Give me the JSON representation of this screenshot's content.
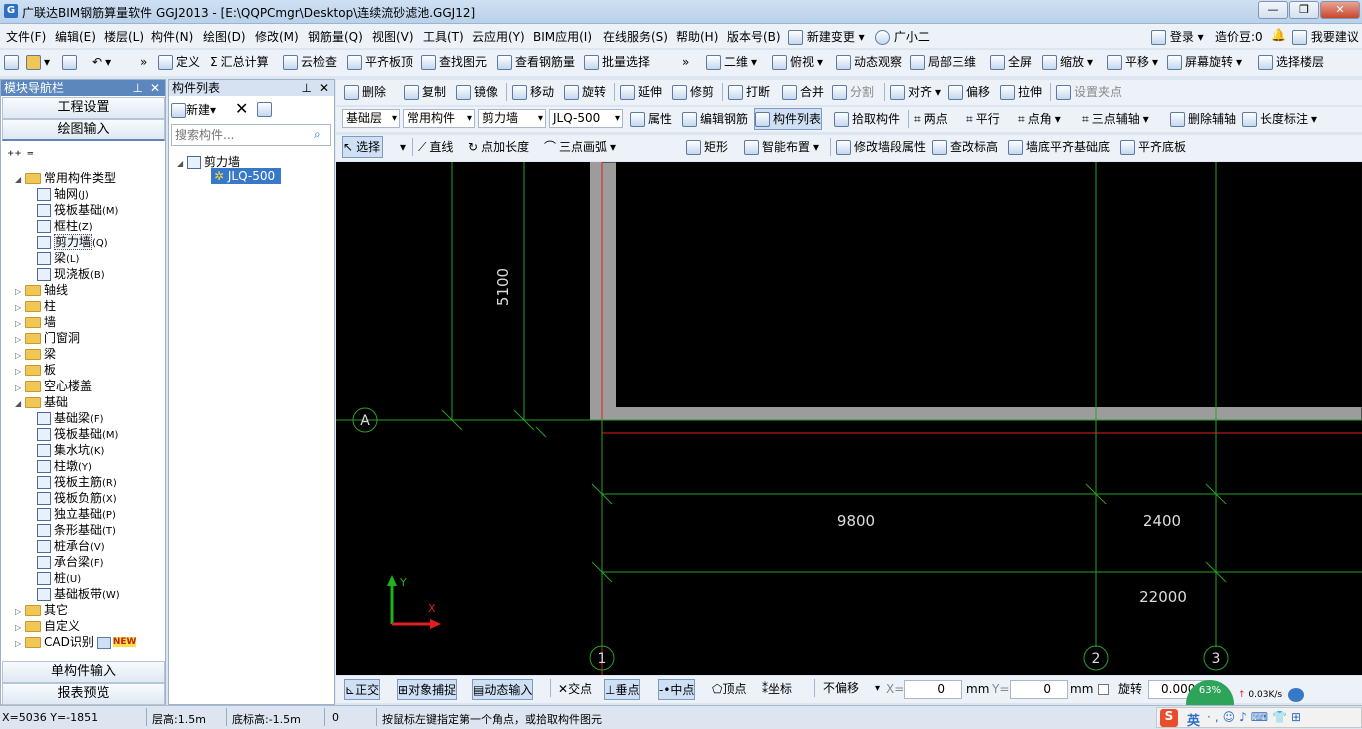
{
  "window": {
    "title": "广联达BIM钢筋算量软件 GGJ2013 - [E:\\QQPCmgr\\Desktop\\连续流砂滤池.GGJ12]",
    "app_icon": "G"
  },
  "menu": [
    "文件(F)",
    "编辑(E)",
    "楼层(L)",
    "构件(N)",
    "绘图(D)",
    "修改(M)",
    "钢筋量(Q)",
    "视图(V)",
    "工具(T)",
    "云应用(Y)",
    "BIM应用(I)",
    "在线服务(S)",
    "帮助(H)",
    "版本号(B)",
    "新建变更",
    "广小二"
  ],
  "menu_right": {
    "login": "登录",
    "price_beans": "造价豆:0",
    "suggest": "我要建议"
  },
  "toolbar1": {
    "define": "定义",
    "sum": "汇总计算",
    "cloud_check": "云检查",
    "flush_top": "平齐板顶",
    "find": "查找图元",
    "view_rebar": "查看钢筋量",
    "batch_select": "批量选择",
    "view_2d": "二维",
    "top_view": "俯视",
    "dyn_view": "动态观察",
    "local_3d": "局部三维",
    "fullscreen": "全屏",
    "zoom": "缩放",
    "pan": "平移",
    "rotate": "屏幕旋转",
    "choose_floor": "选择楼层"
  },
  "toolbar2": {
    "delete": "删除",
    "copy": "复制",
    "mirror": "镜像",
    "move": "移动",
    "rotate": "旋转",
    "extend": "延伸",
    "trim": "修剪",
    "break": "打断",
    "merge": "合并",
    "split": "分割",
    "align": "对齐",
    "offset": "偏移",
    "stretch": "拉伸",
    "set_grip": "设置夹点"
  },
  "toolbar3": {
    "layer": "基础层",
    "type": "常用构件",
    "category": "剪力墙",
    "component": "JLQ-500",
    "props": "属性",
    "edit_rebar": "编辑钢筋",
    "comp_list": "构件列表",
    "pick": "拾取构件",
    "two_point": "两点",
    "parallel": "平行",
    "point_angle": "点角",
    "three_axis": "三点辅轴",
    "del_axis": "删除辅轴",
    "length_dim": "长度标注"
  },
  "toolbar4": {
    "select": "选择",
    "line": "直线",
    "point_len": "点加长度",
    "arc3": "三点画弧",
    "rect": "矩形",
    "smart": "智能布置",
    "modify_seg": "修改墙段属性",
    "check_elev": "查改标高",
    "wall_flush": "墙底平齐基础底",
    "flush_bottom": "平齐底板"
  },
  "left_nav": {
    "title": "模块导航栏",
    "btn_project": "工程设置",
    "btn_draw": "绘图输入",
    "btn_single": "单构件输入",
    "btn_report": "报表预览",
    "tree": [
      {
        "label": "常用构件类型",
        "level": 0,
        "type": "folder",
        "open": true
      },
      {
        "label": "轴网",
        "key": "(J)",
        "level": 1,
        "type": "leaf"
      },
      {
        "label": "筏板基础",
        "key": "(M)",
        "level": 1,
        "type": "leaf"
      },
      {
        "label": "框柱",
        "key": "(Z)",
        "level": 1,
        "type": "leaf"
      },
      {
        "label": "剪力墙",
        "key": "(Q)",
        "level": 1,
        "type": "leaf",
        "selected": true
      },
      {
        "label": "梁",
        "key": "(L)",
        "level": 1,
        "type": "leaf"
      },
      {
        "label": "现浇板",
        "key": "(B)",
        "level": 1,
        "type": "leaf"
      },
      {
        "label": "轴线",
        "level": 0,
        "type": "folder"
      },
      {
        "label": "柱",
        "level": 0,
        "type": "folder"
      },
      {
        "label": "墙",
        "level": 0,
        "type": "folder"
      },
      {
        "label": "门窗洞",
        "level": 0,
        "type": "folder"
      },
      {
        "label": "梁",
        "level": 0,
        "type": "folder"
      },
      {
        "label": "板",
        "level": 0,
        "type": "folder"
      },
      {
        "label": "空心楼盖",
        "level": 0,
        "type": "folder"
      },
      {
        "label": "基础",
        "level": 0,
        "type": "folder",
        "open": true
      },
      {
        "label": "基础梁",
        "key": "(F)",
        "level": 1,
        "type": "leaf"
      },
      {
        "label": "筏板基础",
        "key": "(M)",
        "level": 1,
        "type": "leaf"
      },
      {
        "label": "集水坑",
        "key": "(K)",
        "level": 1,
        "type": "leaf"
      },
      {
        "label": "柱墩",
        "key": "(Y)",
        "level": 1,
        "type": "leaf"
      },
      {
        "label": "筏板主筋",
        "key": "(R)",
        "level": 1,
        "type": "leaf"
      },
      {
        "label": "筏板负筋",
        "key": "(X)",
        "level": 1,
        "type": "leaf"
      },
      {
        "label": "独立基础",
        "key": "(P)",
        "level": 1,
        "type": "leaf"
      },
      {
        "label": "条形基础",
        "key": "(T)",
        "level": 1,
        "type": "leaf"
      },
      {
        "label": "桩承台",
        "key": "(V)",
        "level": 1,
        "type": "leaf"
      },
      {
        "label": "承台梁",
        "key": "(F)",
        "level": 1,
        "type": "leaf"
      },
      {
        "label": "桩",
        "key": "(U)",
        "level": 1,
        "type": "leaf"
      },
      {
        "label": "基础板带",
        "key": "(W)",
        "level": 1,
        "type": "leaf"
      },
      {
        "label": "其它",
        "level": 0,
        "type": "folder"
      },
      {
        "label": "自定义",
        "level": 0,
        "type": "folder"
      },
      {
        "label": "CAD识别",
        "level": 0,
        "type": "folder",
        "badge": "NEW"
      }
    ]
  },
  "comp_list": {
    "title": "构件列表",
    "new_btn": "新建",
    "search_placeholder": "搜索构件...",
    "root": "剪力墙",
    "item": "JLQ-500"
  },
  "canvas": {
    "dim_5100": "5100",
    "dim_9800": "9800",
    "dim_2400": "2400",
    "dim_22000": "22000",
    "axis_a": "A",
    "axis_1": "1",
    "axis_2": "2",
    "axis_3": "3",
    "ucs_y": "Y",
    "ucs_x": "X"
  },
  "bottombar": {
    "ortho": "正交",
    "snap": "对象捕捉",
    "dyn_input": "动态输入",
    "intersect": "交点",
    "perp": "垂点",
    "mid": "中点",
    "vertex": "顶点",
    "coord": "坐标",
    "offset_mode": "不偏移",
    "x_label": "X=",
    "x_val": "0",
    "y_label": "Y=",
    "y_val": "0",
    "mm1": "mm",
    "mm2": "mm",
    "rotate": "旋转",
    "rot_val": "0.000",
    "net_speed": "0.03K/s",
    "percent": "63%"
  },
  "status": {
    "coords": "X=5036 Y=-1851",
    "floor_h": "层高:1.5m",
    "bottom_h": "底标高:-1.5m",
    "zero": "0",
    "hint": "按鼠标左键指定第一个角点，或拾取构件图元",
    "ime": "英"
  }
}
